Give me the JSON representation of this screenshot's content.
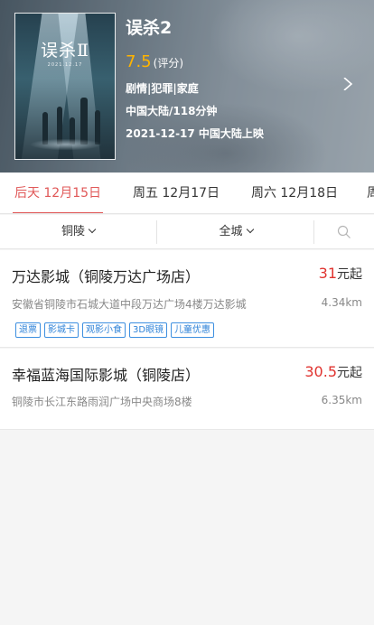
{
  "movie": {
    "title": "误杀2",
    "score": "7.5",
    "score_label": "(评分)",
    "genres": "剧情|犯罪|家庭",
    "region_duration": "中国大陆/118分钟",
    "release": "2021-12-17 中国大陆上映",
    "poster": {
      "title_glyphs": "误杀Ⅱ",
      "subtitle": "2021.12.17"
    }
  },
  "date_tabs": [
    {
      "label": "后天 12月15日",
      "active": true
    },
    {
      "label": "周五 12月17日",
      "active": false
    },
    {
      "label": "周六 12月18日",
      "active": false
    },
    {
      "label": "周",
      "active": false
    }
  ],
  "filters": {
    "city": "铜陵",
    "district": "全城",
    "search_icon": "search-icon"
  },
  "cinemas": [
    {
      "name": "万达影城（铜陵万达广场店）",
      "price": "31",
      "price_unit": "元起",
      "address": "安徽省铜陵市石城大道中段万达广场4楼万达影城",
      "distance": "4.34km",
      "tags": [
        "退票",
        "影城卡",
        "观影小食",
        "3D眼镜",
        "儿童优惠"
      ]
    },
    {
      "name": "幸福蓝海国际影城（铜陵店）",
      "price": "30.5",
      "price_unit": "元起",
      "address": "铜陵市长江东路雨润广场中央商场8楼",
      "distance": "6.35km",
      "tags": []
    }
  ],
  "colors": {
    "accent_red": "#e05757",
    "price_red": "#e0332f",
    "score_gold": "#ffb400",
    "tag_blue": "#2d82d8"
  }
}
